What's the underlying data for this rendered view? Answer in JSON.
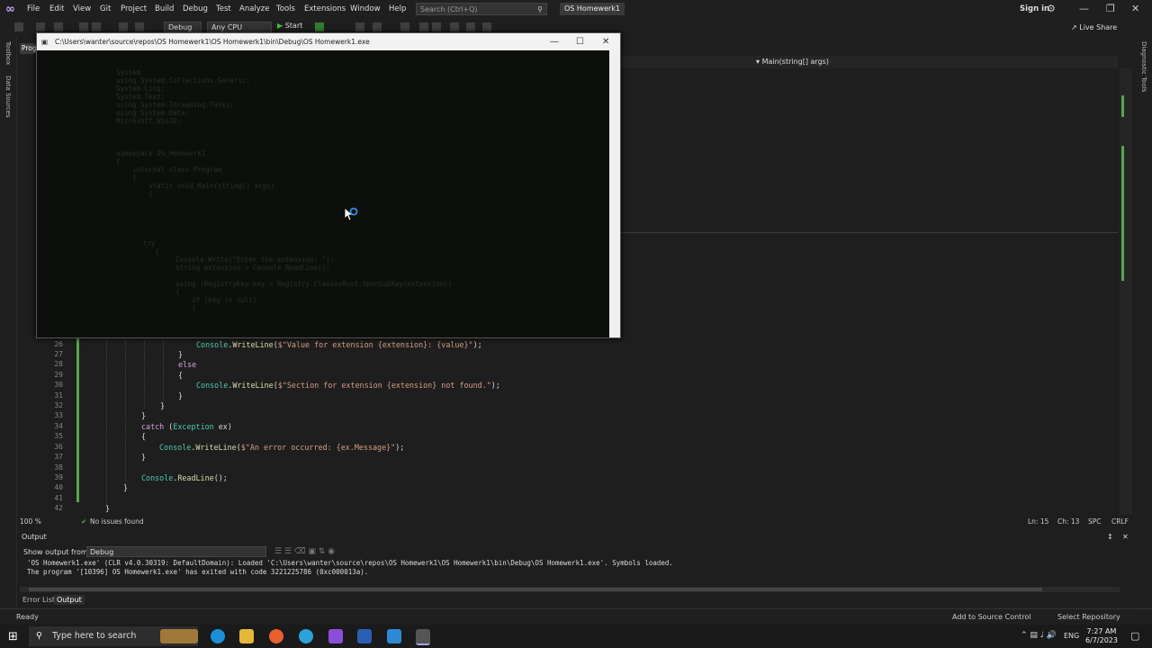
{
  "menubar": {
    "items": [
      "File",
      "Edit",
      "View",
      "Git",
      "Project",
      "Build",
      "Debug",
      "Test",
      "Analyze",
      "Tools",
      "Extensions",
      "Window",
      "Help"
    ],
    "search_placeholder": "Search (Ctrl+Q)",
    "solution_name": "OS Homewerk1",
    "sign_in": "Sign in"
  },
  "toolbar": {
    "config": "Debug",
    "platform": "Any CPU",
    "start": "Start",
    "live_share": "Live Share"
  },
  "left_rail": [
    "Toolbox",
    "Data Sources"
  ],
  "right_rail": [
    "Diagnostic Tools"
  ],
  "editor": {
    "doc_tab": "Prog",
    "nav_method": "Main(string[] args)",
    "lines": [
      {
        "n": "26",
        "text": "Console.WriteLine($\"Value for extension {extension}: {value}\");"
      },
      {
        "n": "27",
        "text": "}"
      },
      {
        "n": "28",
        "text": "else"
      },
      {
        "n": "29",
        "text": "{"
      },
      {
        "n": "30",
        "text": "Console.WriteLine($\"Section for extension {extension} not found.\");"
      },
      {
        "n": "31",
        "text": "}"
      },
      {
        "n": "32",
        "text": "}"
      },
      {
        "n": "33",
        "text": "}"
      },
      {
        "n": "34",
        "text": "catch (Exception ex)"
      },
      {
        "n": "35",
        "text": "{"
      },
      {
        "n": "36",
        "text": "Console.WriteLine($\"An error occurred: {ex.Message}\");"
      },
      {
        "n": "37",
        "text": "}"
      },
      {
        "n": "38",
        "text": ""
      },
      {
        "n": "39",
        "text": "Console.ReadLine();"
      },
      {
        "n": "40",
        "text": "}"
      },
      {
        "n": "41",
        "text": ""
      },
      {
        "n": "42",
        "text": "}"
      }
    ],
    "zoom": "100 %",
    "issues": "No issues found",
    "ln": "Ln: 15",
    "ch": "Ch: 13",
    "spc": "SPC",
    "crlf": "CRLF"
  },
  "output": {
    "title": "Output",
    "show_from_label": "Show output from:",
    "show_from_value": "Debug",
    "lines": [
      "'OS Homewerk1.exe' (CLR v4.0.30319: DefaultDomain): Loaded 'C:\\Users\\wanter\\source\\repos\\OS Homewerk1\\OS Homewerk1\\bin\\Debug\\OS Homewerk1.exe'. Symbols loaded.",
      "The program '[10396] OS Homewerk1.exe' has exited with code 3221225786 (0xc000013a)."
    ],
    "tabs": [
      "Error List",
      "Output"
    ]
  },
  "status": {
    "ready": "Ready",
    "add_source": "Add to Source Control",
    "select_repo": "Select Repository"
  },
  "console": {
    "title": "C:\\Users\\wanter\\source\\repos\\OS Homewerk1\\OS Homewerk1\\bin\\Debug\\OS Homewerk1.exe"
  },
  "taskbar": {
    "search_placeholder": "Type here to search",
    "lang": "ENG",
    "time": "7:27 AM",
    "date": "6/7/2023"
  }
}
